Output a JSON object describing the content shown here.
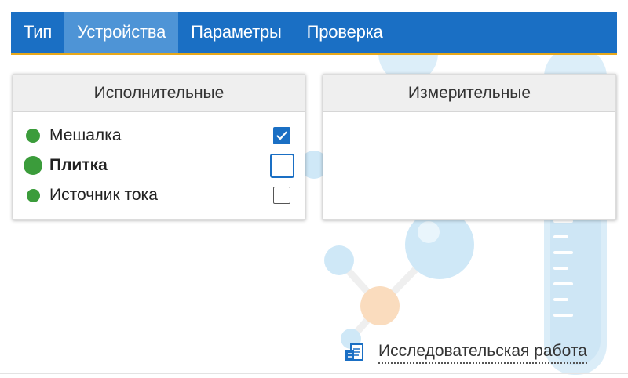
{
  "tabs": [
    {
      "label": "Тип",
      "active": false
    },
    {
      "label": "Устройства",
      "active": true
    },
    {
      "label": "Параметры",
      "active": false
    },
    {
      "label": "Проверка",
      "active": false
    }
  ],
  "panels": {
    "executive": {
      "title": "Исполнительные",
      "devices": [
        {
          "label": "Мешалка",
          "checked": true,
          "indicator_color": "#3b9c3b"
        },
        {
          "label": "Плитка",
          "checked": false,
          "focused": true,
          "indicator_color": "#3b9c3b"
        },
        {
          "label": "Источник тока",
          "checked": false,
          "indicator_color": "#3b9c3b"
        }
      ]
    },
    "measuring": {
      "title": "Измерительные",
      "devices": []
    }
  },
  "footer": {
    "research_link": "Исследовательская работа",
    "icon": "report-icon"
  },
  "colors": {
    "tab_bar": "#1a6fc4",
    "tab_active": "#4e94d6",
    "tab_underline": "#e8a81a",
    "indicator": "#3b9c3b",
    "checkbox_checked": "#1a6fc4"
  }
}
